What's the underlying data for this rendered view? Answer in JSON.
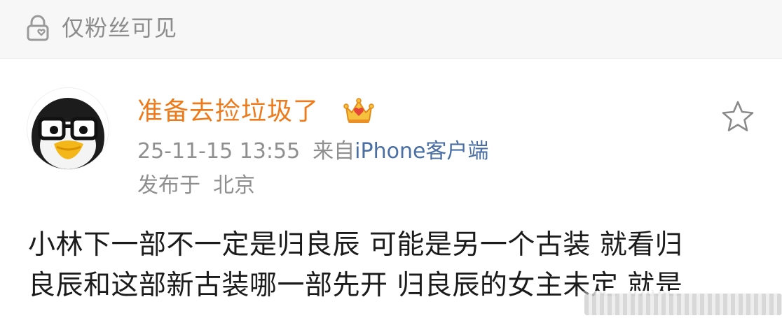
{
  "visibility": {
    "icon": "lock-heart-icon",
    "label": "仅粉丝可见"
  },
  "post": {
    "author": {
      "name": "准备去捡垃圾了",
      "avatar": "penguin-with-glasses-avatar",
      "badge_icon": "crown-icon"
    },
    "timestamp": "25-11-15 13:55",
    "source_prefix": "来自",
    "source": "iPhone客户端",
    "location_prefix": "发布于",
    "location": "北京",
    "body_lines": [
      "小林下一部不一定是归良辰 可能是另一个古装 就看归",
      "良辰和这部新古装哪一部先开 归良辰的女主未定 就是"
    ],
    "favorite_icon": "star-outline-icon"
  },
  "colors": {
    "username": "#ee7b1b",
    "meta_text": "#8f8f8f",
    "source_link": "#4a6fa5",
    "body_text": "#1b1b1b",
    "top_bar_bg": "#f7f7f7"
  }
}
